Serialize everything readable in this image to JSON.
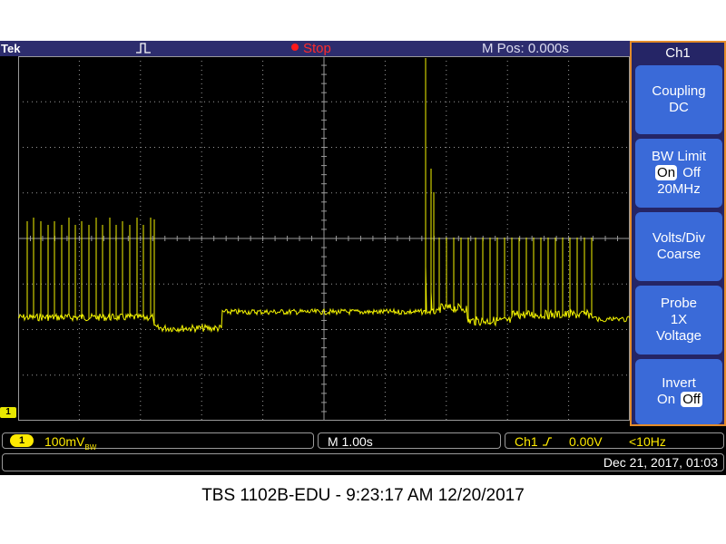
{
  "brand": "Tek",
  "acquisition": {
    "state": "Stop"
  },
  "horizontal_position": "M Pos: 0.000s",
  "channel_marker": "1",
  "side_menu": {
    "title": "Ch1",
    "coupling": {
      "label": "Coupling",
      "value": "DC"
    },
    "bw_limit": {
      "label": "BW Limit",
      "on": "On",
      "off": "Off",
      "freq": "20MHz",
      "selected": "On"
    },
    "volts_div": {
      "label": "Volts/Div",
      "value": "Coarse"
    },
    "probe": {
      "label": "Probe",
      "value": "1X",
      "type": "Voltage"
    },
    "invert": {
      "label": "Invert",
      "on": "On",
      "off": "Off",
      "selected": "Off"
    }
  },
  "status": {
    "channel": "1",
    "volts_per_div": "100mV",
    "bw_suffix": "BW",
    "timebase": "M 1.00s",
    "trigger_source": "Ch1",
    "trigger_slope_icon": "rising-edge-icon",
    "trigger_level": "0.00V",
    "trigger_freq": "<10Hz"
  },
  "datetime": "Dec 21, 2017, 01:03",
  "caption": "TBS 1102B-EDU - 9:23:17 AM   12/20/2017",
  "colors": {
    "trace": "#f5f500",
    "grid": "#9a9a9a",
    "panel": "#2d2d6e",
    "button": "#3a6ad8",
    "accent": "#e38c2a"
  }
}
